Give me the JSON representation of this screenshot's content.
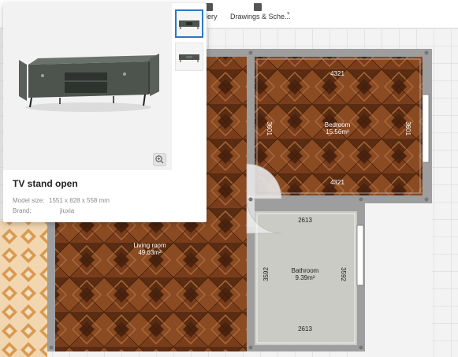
{
  "toolbar": {
    "gallery_label": "allery",
    "drawings_label": "Drawings & Sche...",
    "caret": "▾"
  },
  "product_card": {
    "title": "TV stand open",
    "model_size_label": "Model size:",
    "model_size_value": "1551 x 828 x 558 mm",
    "brand_label": "Brand:",
    "brand_value": "jiuxia",
    "zoom_icon": "zoom-in-icon"
  },
  "floorplan": {
    "rooms": [
      {
        "name": "Bedroom",
        "area": "15.56m²"
      },
      {
        "name": "Living room",
        "area": "49.63m²"
      },
      {
        "name": "Bathroom",
        "area": "9.39m²"
      }
    ],
    "dimensions": {
      "bedroom_top": "4321",
      "bedroom_bottom": "4321",
      "bedroom_left": "3601",
      "bedroom_right": "3601",
      "bathroom_top": "2613",
      "bathroom_bottom": "2613",
      "bathroom_left": "3592",
      "bathroom_right": "3592"
    }
  },
  "colors": {
    "wood_dark": "#5a2e14",
    "wood_light": "#9a5a2c",
    "wall": "#9e9e9e",
    "bathroom_floor": "#c9cbc4",
    "accent": "#2b78c5",
    "tile": "#d99a50"
  }
}
